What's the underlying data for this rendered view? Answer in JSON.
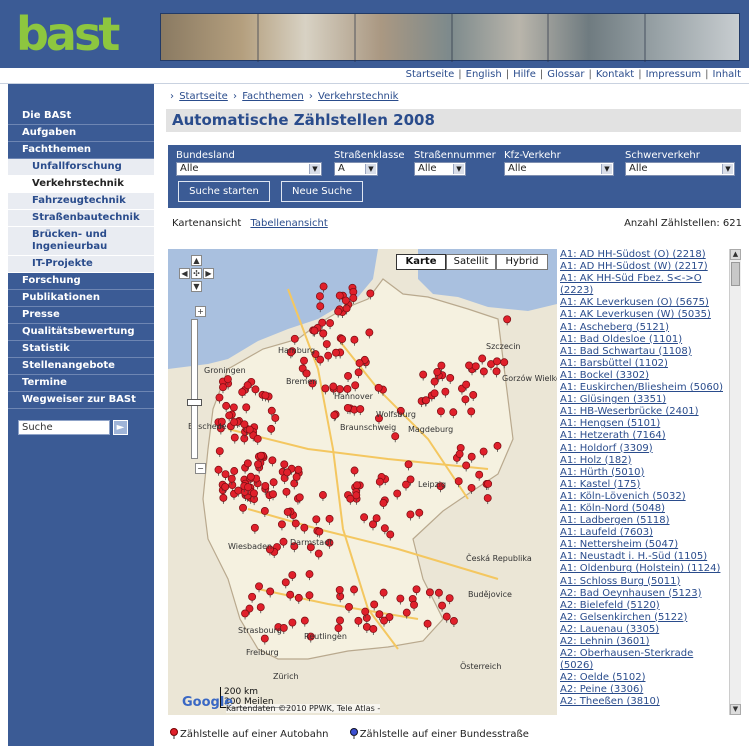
{
  "header": {
    "logo": "bast"
  },
  "topnav": [
    "Startseite",
    "English",
    "Hilfe",
    "Glossar",
    "Kontakt",
    "Impressum",
    "Inhalt"
  ],
  "sidebar": {
    "items": [
      {
        "label": "Die BASt"
      },
      {
        "label": "Aufgaben"
      },
      {
        "label": "Fachthemen"
      }
    ],
    "subitems": [
      {
        "label": "Unfallforschung"
      },
      {
        "label": "Verkehrstechnik"
      },
      {
        "label": "Fahrzeugtechnik"
      },
      {
        "label": "Straßenbautechnik"
      },
      {
        "label": "Brücken- und Ingenieurbau"
      },
      {
        "label": "IT-Projekte"
      }
    ],
    "items2": [
      {
        "label": "Forschung"
      },
      {
        "label": "Publikationen"
      },
      {
        "label": "Presse"
      },
      {
        "label": "Qualitätsbewertung"
      },
      {
        "label": "Statistik"
      },
      {
        "label": "Stellenangebote"
      },
      {
        "label": "Termine"
      },
      {
        "label": "Wegweiser zur BASt"
      }
    ],
    "search_placeholder": "Suche"
  },
  "breadcrumb": [
    "Startseite",
    "Fachthemen",
    "Verkehrstechnik"
  ],
  "page_title": "Automatische Zählstellen 2008",
  "filters": {
    "bundesland": {
      "label": "Bundesland",
      "value": "Alle"
    },
    "strassenklasse": {
      "label": "Straßenklasse",
      "value": "A"
    },
    "strassennummer": {
      "label": "Straßennummer",
      "value": "Alle"
    },
    "kfz": {
      "label": "Kfz-Verkehr",
      "value": "Alle"
    },
    "schwer": {
      "label": "Schwerverkehr",
      "value": "Alle"
    },
    "search_button": "Suche starten",
    "new_button": "Neue Suche"
  },
  "views": {
    "map_view": "Kartenansicht",
    "table_view": "Tabellenansicht",
    "count": "Anzahl Zählstellen: 621"
  },
  "map": {
    "types": [
      "Karte",
      "Satellit",
      "Hybrid"
    ],
    "logo": "Google",
    "scale_km": "200 km",
    "scale_mi": "200 Meilen",
    "copyright": "Kartendaten ©2010 PPWK, Tele Atlas -",
    "pin_color": "#e0202b",
    "city_labels": [
      "Hamburg",
      "Bremen",
      "Hannover",
      "Wolfsburg",
      "Braunschweig",
      "Magdeburg",
      "Groningen",
      "Enschede",
      "Leipzig",
      "Wiesbaden",
      "Darmstadt",
      "Strasbourg",
      "Reutlingen",
      "Zürich",
      "Freiburg",
      "Groningen",
      "Gorzów Wielkopolski",
      "Česká Republika",
      "Österreich",
      "Budějovice",
      "Szczecin"
    ]
  },
  "list": [
    "A1: AD HH-Südost (O) (2218)",
    "A1: AD HH-Südost (W) (2217)",
    "A1: AK HH-Süd Fbez. S<->O",
    "(2223)",
    "A1: AK Leverkusen (O) (5675)",
    "A1: AK Leverkusen (W) (5035)",
    "A1: Ascheberg (5121)",
    "A1: Bad Oldesloe (1101)",
    "A1: Bad Schwartau (1108)",
    "A1: Barsbüttel (1102)",
    "A1: Bockel (3302)",
    "A1: Euskirchen/Bliesheim (5060)",
    "A1: Glüsingen (3351)",
    "A1: HB-Weserbrücke (2401)",
    "A1: Hengsen (5101)",
    "A1: Hetzerath (7164)",
    "A1: Holdorf (3309)",
    "A1: Holz (182)",
    "A1: Hürth (5010)",
    "A1: Kastel (175)",
    "A1: Köln-Lövenich (5032)",
    "A1: Köln-Nord (5048)",
    "A1: Ladbergen (5118)",
    "A1: Laufeld (7603)",
    "A1: Nettersheim (5047)",
    "A1: Neustadt i. H.-Süd (1105)",
    "A1: Oldenburg (Holstein) (1124)",
    "A1: Schloss Burg (5011)",
    "A2: Bad Oeynhausen (5123)",
    "A2: Bielefeld (5120)",
    "A2: Gelsenkirchen (5122)",
    "A2: Lauenau (3305)",
    "A2: Lehnin (3601)",
    "A2: Oberhausen-Sterkrade",
    "(5026)",
    "A2: Oelde (5102)",
    "A2: Peine (3306)",
    "A2: Theeßen (3810)"
  ],
  "legend": {
    "autobahn": "Zählstelle auf einer Autobahn",
    "bundesstrasse": "Zählstelle auf einer Bundesstraße",
    "autobahn_color": "#e0202b",
    "bundesstrasse_color": "#3b4fd0"
  }
}
